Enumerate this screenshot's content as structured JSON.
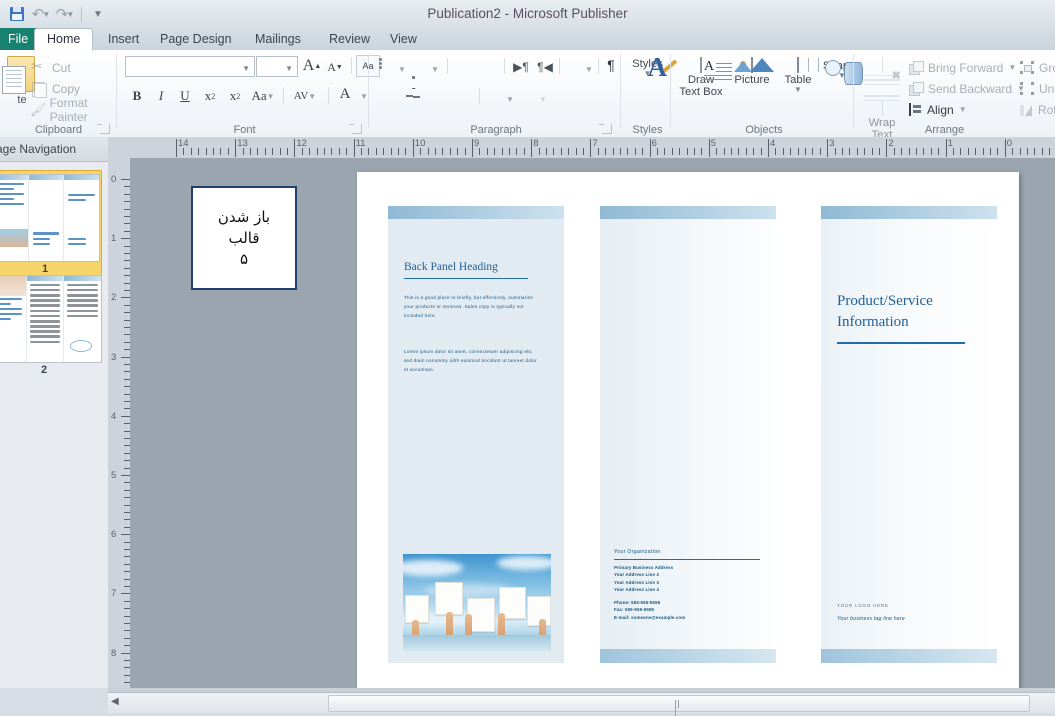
{
  "window": {
    "title": "Publication2  -  Microsoft Publisher"
  },
  "quick_access": {
    "save": "Save",
    "undo": "Undo",
    "redo": "Redo",
    "customize": "Customize Quick Access Toolbar"
  },
  "tabs": [
    {
      "label": "File",
      "active": false
    },
    {
      "label": "Home",
      "active": true
    },
    {
      "label": "Insert",
      "active": false
    },
    {
      "label": "Page Design",
      "active": false
    },
    {
      "label": "Mailings",
      "active": false
    },
    {
      "label": "Review",
      "active": false
    },
    {
      "label": "View",
      "active": false
    }
  ],
  "ribbon": {
    "clipboard": {
      "label": "Clipboard",
      "paste": "te",
      "cut": "Cut",
      "copy": "Copy",
      "format_painter": "Format Painter"
    },
    "font": {
      "label": "Font",
      "font_name_value": "",
      "font_size_value": "",
      "grow_font": "A",
      "shrink_font": "A",
      "clear_formatting": "Aa",
      "bold": "B",
      "italic": "I",
      "underline": "U",
      "subscript": "x",
      "subscript_sub": "2",
      "superscript": "x",
      "superscript_sup": "2",
      "change_case": "Aa",
      "character_spacing": "AV",
      "font_color": "A"
    },
    "paragraph": {
      "label": "Paragraph",
      "show_marks": "¶"
    },
    "styles": {
      "label": "Styles",
      "button": "Styles"
    },
    "objects": {
      "label": "Objects",
      "draw_text_box_line1": "Draw",
      "draw_text_box_line2": "Text Box",
      "picture": "Picture",
      "table": "Table",
      "shapes": "Shapes"
    },
    "arrange": {
      "label": "Arrange",
      "wrap_text_line1": "Wrap",
      "wrap_text_line2": "Text",
      "bring_forward": "Bring Forward",
      "send_backward": "Send Backward",
      "align": "Align",
      "group": "Gro",
      "ungroup": "Ung",
      "rotate": "Rot"
    }
  },
  "navigation": {
    "title": "Page Navigation",
    "collapse": "❮",
    "pages": [
      {
        "number": "1",
        "selected": true
      },
      {
        "number": "2",
        "selected": false
      }
    ]
  },
  "rulers": {
    "horizontal": [
      "14",
      "13",
      "12",
      "11",
      "10",
      "9",
      "8",
      "7",
      "6",
      "5",
      "4",
      "3",
      "2",
      "1",
      "0"
    ],
    "vertical": [
      "0",
      "1",
      "2",
      "3",
      "4",
      "5",
      "6",
      "7",
      "8"
    ]
  },
  "annotation": {
    "line1": "باز شدن",
    "line2": "قالب",
    "line3": "۵"
  },
  "publication": {
    "back_panel": {
      "heading": "Back Panel Heading",
      "paragraph1": "This is a good place to briefly, but effectively, summarize your products or services. Sales copy is typically not included here.",
      "paragraph2": "Lorem ipsum dolor sit amet, consectetuer adipiscing elit, sed diam nonummy nibh euismod tincidunt ut laoreet dolor et accumsan."
    },
    "middle_panel": {
      "organization": "Your Organization",
      "address": [
        "Primary Business Address",
        "Your Address Line 2",
        "Your Address Line 3",
        "Your Address Line 4"
      ],
      "contact": [
        "Phone: 555-555-5555",
        "Fax: 555-555-5555",
        "E-mail: someone@example.com"
      ]
    },
    "front_panel": {
      "heading_line1": "Product/Service",
      "heading_line2": "Information",
      "logo": "YOUR LOGO HERE",
      "tagline": "Your business tag line here"
    }
  },
  "colors": {
    "accent_blue": "#1f6ea8",
    "heading_blue": "#1f5f94",
    "panel_fill": "#e3ebf2",
    "file_tab_green": "#18816f",
    "selection_gold": "#f6d66a"
  }
}
